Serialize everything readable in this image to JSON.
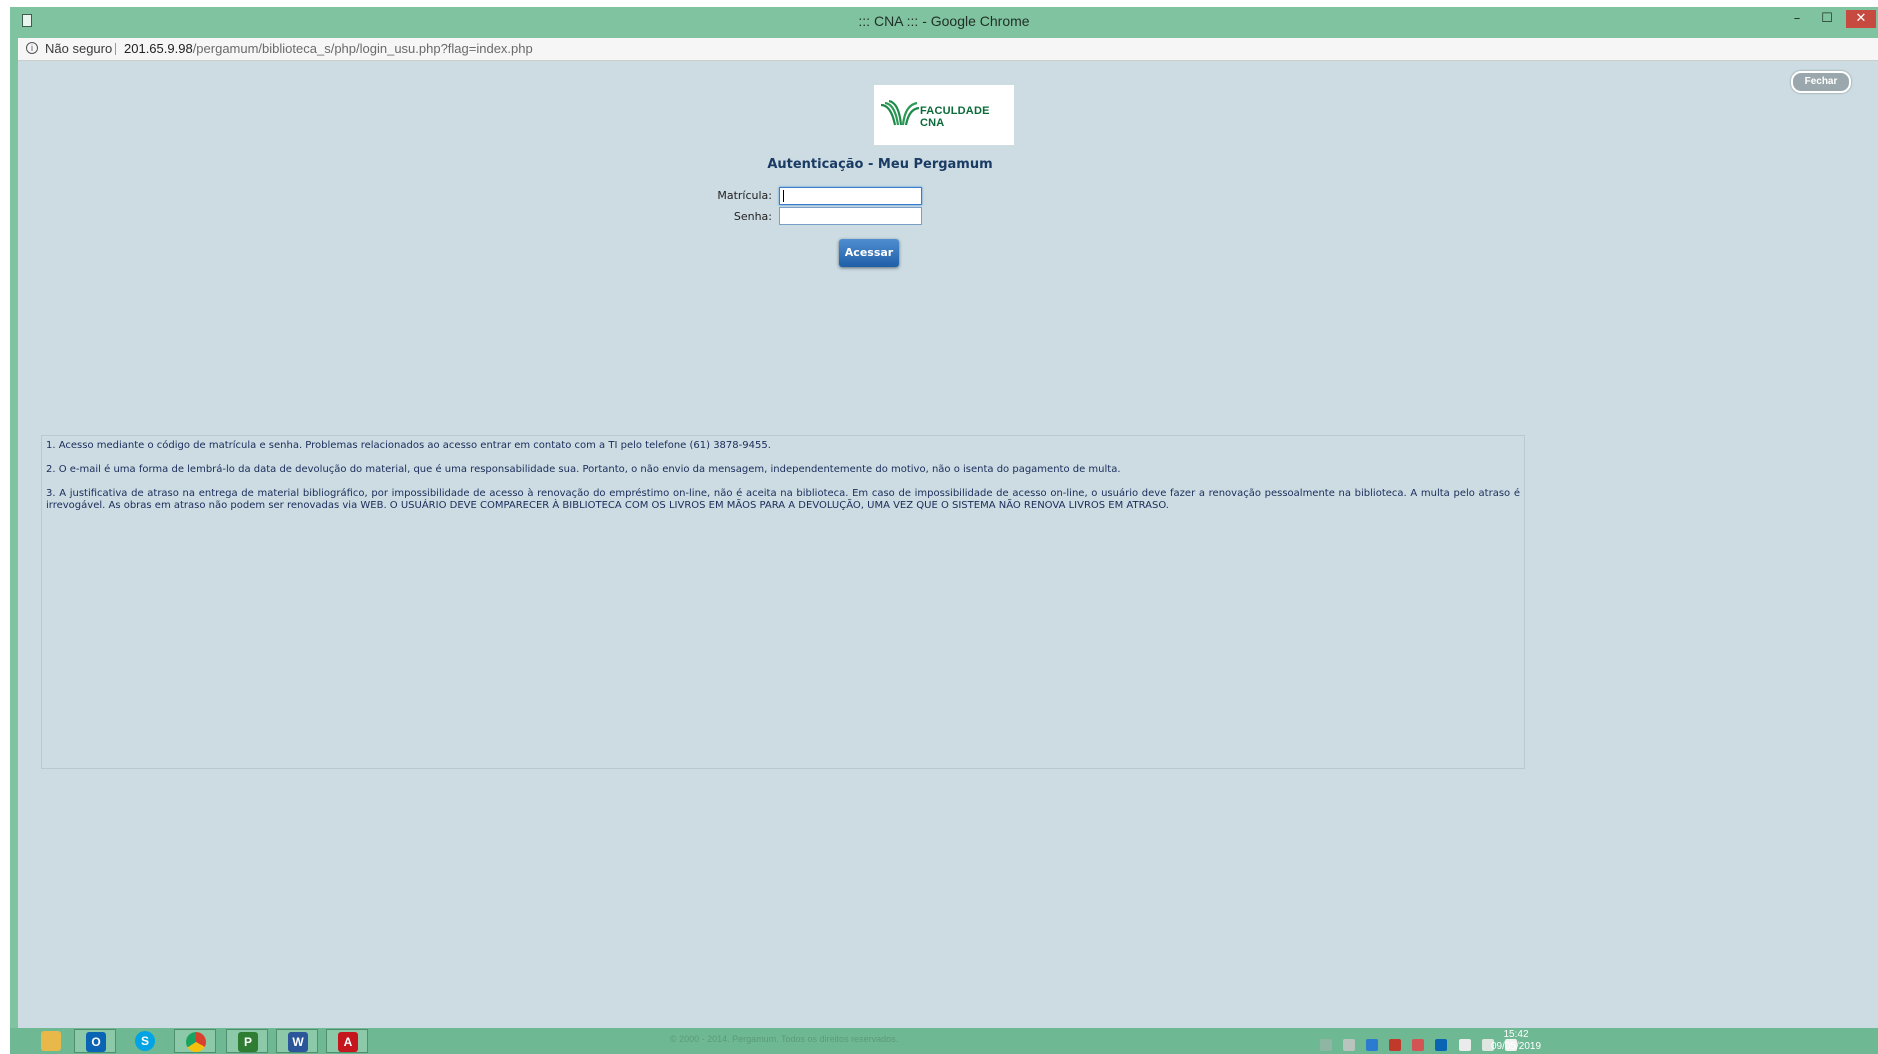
{
  "window": {
    "title": "::: CNA ::: - Google Chrome",
    "minimize_glyph": "–",
    "maximize_glyph": "☐",
    "close_glyph": "✕"
  },
  "address_bar": {
    "security_label": "Não seguro",
    "url_host": "201.65.9.98",
    "url_path": "/pergamum/biblioteca_s/php/login_usu.php?flag=index.php",
    "icon": "info-icon"
  },
  "page": {
    "close_button": "Fechar",
    "logo_text": "FACULDADE CNA",
    "heading": "Autenticação - Meu Pergamum",
    "form": {
      "matricula_label": "Matrícula:",
      "matricula_value": "",
      "senha_label": "Senha:",
      "senha_value": "",
      "submit_label": "Acessar"
    },
    "notes": [
      "1. Acesso mediante o código de matrícula e senha. Problemas relacionados ao acesso entrar em contato com a TI pelo telefone (61) 3878-9455.",
      "2. O e-mail é uma forma de lembrá-lo da data de devolução do material, que é uma responsabilidade sua. Portanto, o não envio da mensagem, independentemente do motivo, não o isenta do pagamento de multa.",
      "3. A justificativa de atraso na entrega de material bibliográfico, por impossibilidade de acesso à renovação do empréstimo on-line, não é aceita na biblioteca. Em caso de impossibilidade de acesso on-line, o usuário deve fazer a renovação pessoalmente na biblioteca. A multa pelo atraso é irrevogável. As obras em atraso não podem ser renovadas via WEB. O USUÁRIO DEVE COMPARECER À BIBLIOTECA COM OS LIVROS EM MÃOS PARA A DEVOLUÇÃO, UMA VEZ QUE O SISTEMA NÃO RENOVA LIVROS EM ATRASO."
    ],
    "footer_copyright": "© 2000 - 2014. Pergamum. Todos os direitos reservados."
  },
  "taskbar": {
    "apps": [
      {
        "name": "file-explorer-icon",
        "glyph": "",
        "color": "#e8b84a",
        "active": false
      },
      {
        "name": "outlook-icon",
        "glyph": "O",
        "color": "#0a64b4",
        "active": true
      },
      {
        "name": "skype-icon",
        "glyph": "S",
        "color": "#00a4e4",
        "active": false
      },
      {
        "name": "chrome-icon",
        "glyph": "",
        "color": "#d9412e",
        "active": true
      },
      {
        "name": "project-icon",
        "glyph": "P",
        "color": "#2f7d32",
        "active": true
      },
      {
        "name": "word-icon",
        "glyph": "W",
        "color": "#2b579a",
        "active": true
      },
      {
        "name": "acrobat-icon",
        "glyph": "A",
        "color": "#c4161c",
        "active": true
      }
    ],
    "clock_time": "15:42",
    "clock_date": "09/05/2019"
  },
  "colors": {
    "window_frame": "#80c3a0",
    "page_background": "#ccdce2",
    "heading": "#1a3b64",
    "button": "#2a6bb8"
  }
}
